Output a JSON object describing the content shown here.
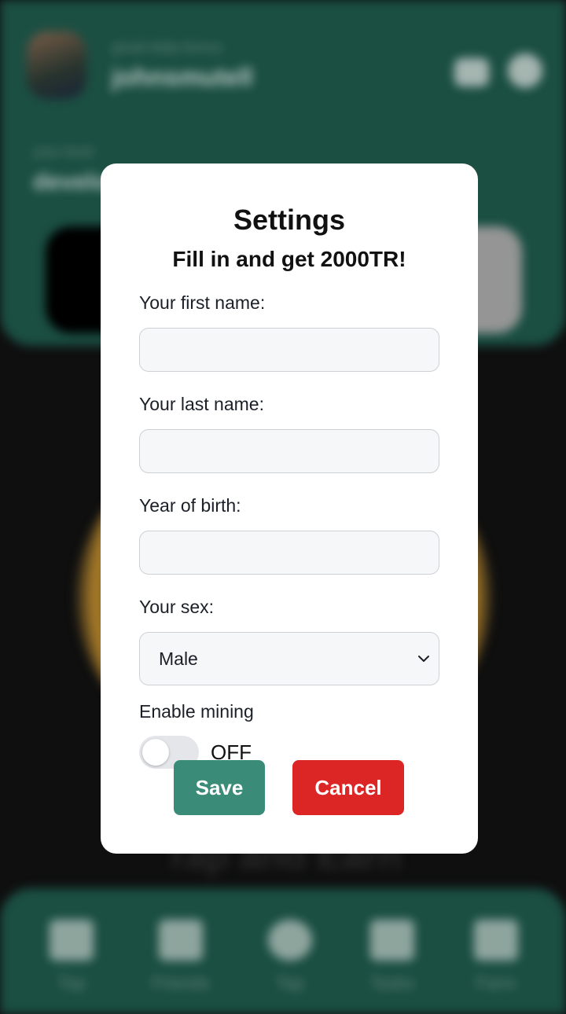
{
  "background": {
    "user_sub": "gmail-daily-bonus",
    "user_name": "johnsmutell",
    "level_sub": "your level",
    "level_value": "developer",
    "tap_title": "Tap and Earn",
    "nav": [
      "Top",
      "Friends",
      "Tap",
      "Tasks",
      "Farm"
    ]
  },
  "modal": {
    "title": "Settings",
    "subtitle": "Fill in and get 2000TR!",
    "first_name_label": "Your first name:",
    "first_name_value": "",
    "last_name_label": "Your last name:",
    "last_name_value": "",
    "birth_year_label": "Year of birth:",
    "birth_year_value": "",
    "sex_label": "Your sex:",
    "sex_value": "Male",
    "mining_label": "Enable mining",
    "mining_state": "OFF",
    "save_label": "Save",
    "cancel_label": "Cancel"
  },
  "colors": {
    "primary": "#3a8c79",
    "danger": "#dc2626",
    "panel_bg": "#1f5a4c"
  }
}
